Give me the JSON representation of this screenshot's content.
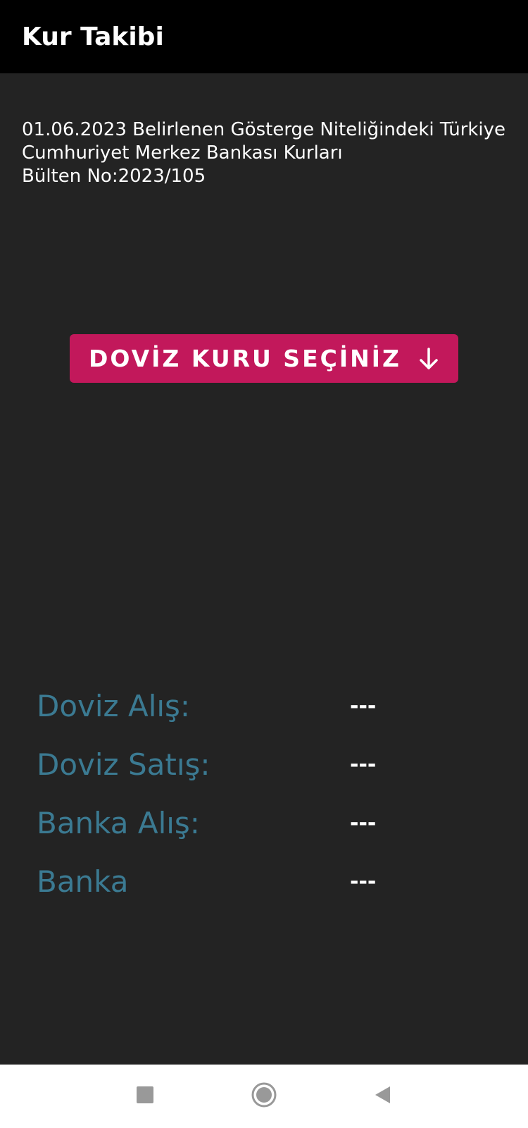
{
  "app_bar": {
    "title": "Kur Takibi"
  },
  "bulletin": {
    "line1": "01.06.2023 Belirlenen Gösterge Niteliğindeki Türkiye",
    "line2": "Cumhuriyet Merkez Bankası Kurları",
    "line3": "Bülten No:2023/105"
  },
  "currency_select": {
    "label": "DOVİZ KURU SEÇİNİZ",
    "icon": "arrow-down-icon"
  },
  "rates": [
    {
      "label": "Doviz Alış:",
      "value": "---"
    },
    {
      "label": "Doviz Satış:",
      "value": "---"
    },
    {
      "label": "Banka Alış:",
      "value": "---"
    },
    {
      "label": "Banka",
      "value": "---"
    }
  ],
  "nav_bar": {
    "recents_icon": "square-icon",
    "home_icon": "circle-icon",
    "back_icon": "triangle-back-icon"
  },
  "colors": {
    "app_bar": "#000000",
    "background": "#232323",
    "accent": "#c2185b",
    "rate_label": "#3b7a92",
    "text": "#ffffff"
  }
}
